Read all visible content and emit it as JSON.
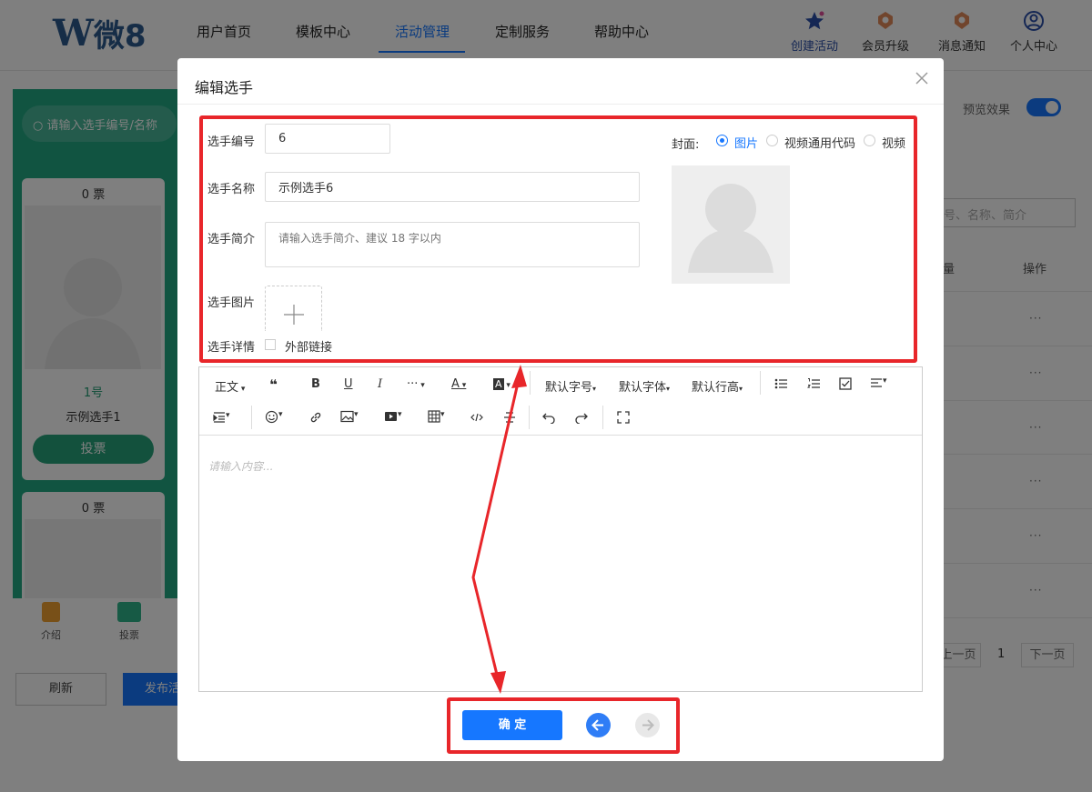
{
  "header": {
    "logo": {
      "mark": "W",
      "text": "微8"
    },
    "nav": [
      "用户首页",
      "模板中心",
      "活动管理",
      "定制服务",
      "帮助中心"
    ],
    "active_nav": "活动管理",
    "actions": [
      {
        "label": "创建活动",
        "icon": "star-icon"
      },
      {
        "label": "会员升级",
        "icon": "medal-icon"
      },
      {
        "label": "消息通知",
        "icon": "notification-icon"
      },
      {
        "label": "个人中心",
        "icon": "user-icon"
      }
    ]
  },
  "background": {
    "search_placeholder": "请输入选手编号/名称",
    "card1": {
      "votes": "0 票",
      "number": "1号",
      "name": "示例选手1",
      "vote_button": "投票"
    },
    "card2": {
      "votes": "0 票"
    },
    "bottom_nav": [
      "介绍",
      "投票"
    ],
    "refresh_button": "刷新",
    "publish_button": "发布活",
    "preview_label": "预览效果",
    "preview_on": true,
    "table_search_placeholder": "号、名称、简介",
    "table_headers": [
      "量",
      "操作"
    ],
    "row_actions": [
      "···",
      "···",
      "···",
      "···",
      "···",
      "···"
    ],
    "pagination": {
      "prev": "上一页",
      "page": "1",
      "next": "下一页"
    }
  },
  "modal": {
    "title": "编辑选手",
    "close_icon": "close-icon",
    "fields": {
      "number_label": "选手编号",
      "number_value": "6",
      "name_label": "选手名称",
      "name_value": "示例选手6",
      "intro_label": "选手简介",
      "intro_placeholder": "请输入选手简介、建议 18 字以内",
      "image_label": "选手图片",
      "detail_label": "选手详情",
      "external_link_label": "外部链接",
      "external_link_checked": false
    },
    "cover": {
      "label": "封面:",
      "options": [
        "图片",
        "视频通用代码",
        "视频"
      ],
      "selected": "图片"
    },
    "editor": {
      "toolbar_row1": [
        "正文",
        "❝",
        "B",
        "U",
        "I",
        "···",
        "A",
        "A",
        "默认字号",
        "默认字体",
        "默认行高"
      ],
      "placeholder": "请输入内容..."
    },
    "confirm_button": "确 定",
    "back_icon": "arrow-left-icon",
    "forward_icon": "arrow-right-icon"
  },
  "colors": {
    "accent": "#1677ff",
    "green": "#22a883",
    "highlight": "#e8262a"
  }
}
